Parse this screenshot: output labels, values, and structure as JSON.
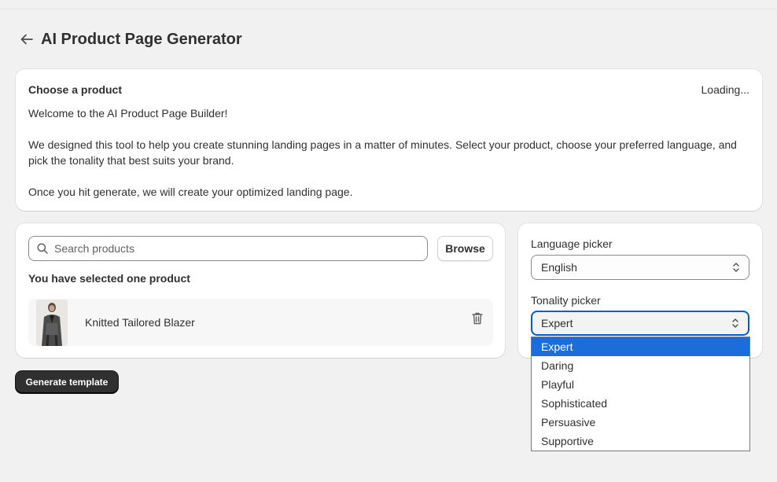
{
  "header": {
    "title": "AI Product Page Generator"
  },
  "intro": {
    "heading": "Choose a product",
    "status": "Loading...",
    "paragraphs": [
      "Welcome to the AI Product Page Builder!",
      "We designed this tool to help you create stunning landing pages in a matter of minutes. Select your product, choose your preferred language, and pick the tonality that best suits your brand.",
      "Once you hit generate, we will create your optimized landing page."
    ]
  },
  "product_picker": {
    "search_placeholder": "Search products",
    "search_value": "",
    "browse_label": "Browse",
    "selected_heading": "You have selected one product",
    "selected_product": {
      "name": "Knitted Tailored Blazer"
    }
  },
  "settings": {
    "language_label": "Language picker",
    "language_value": "English",
    "tonality_label": "Tonality picker",
    "tonality_value": "Expert",
    "tonality_options": [
      "Expert",
      "Daring",
      "Playful",
      "Sophisticated",
      "Persuasive",
      "Supportive"
    ]
  },
  "actions": {
    "generate_label": "Generate template"
  },
  "icons": {
    "back": "arrow-left-icon",
    "search": "search-icon",
    "delete": "trash-icon",
    "select": "chevron-up-down-icon"
  },
  "colors": {
    "accent": "#005bd3",
    "option_highlight": "#1a6ddb",
    "primary_button": "#303030",
    "background": "#f1f1f1"
  }
}
